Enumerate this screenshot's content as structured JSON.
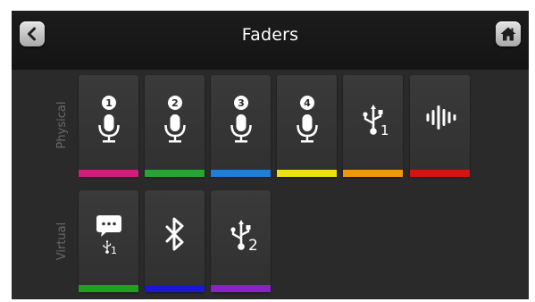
{
  "header": {
    "title": "Faders",
    "back_icon": "chevron-left-icon",
    "home_icon": "home-icon"
  },
  "rows": {
    "physical_label": "Physical",
    "virtual_label": "Virtual"
  },
  "physical": [
    {
      "icon": "microphone-icon",
      "badge": "1",
      "color": "#d01e7a"
    },
    {
      "icon": "microphone-icon",
      "badge": "2",
      "color": "#28a336"
    },
    {
      "icon": "microphone-icon",
      "badge": "3",
      "color": "#1f7fd8"
    },
    {
      "icon": "microphone-icon",
      "badge": "4",
      "color": "#ece212"
    },
    {
      "icon": "usb-icon",
      "sub": "1",
      "color": "#f0980c"
    },
    {
      "icon": "waveform-icon",
      "color": "#d21414"
    }
  ],
  "virtual": [
    {
      "icon": "chat-usb-icon",
      "sub": "1",
      "color": "#1ea21e"
    },
    {
      "icon": "bluetooth-icon",
      "color": "#1c16d6"
    },
    {
      "icon": "usb-icon",
      "sub": "2",
      "color": "#8a22c8"
    }
  ]
}
